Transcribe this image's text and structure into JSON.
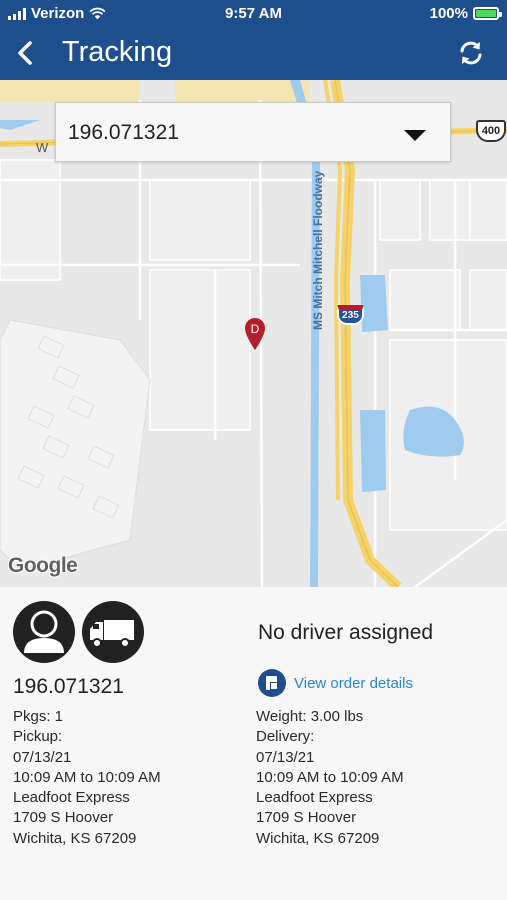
{
  "status_bar": {
    "carrier": "Verizon",
    "time": "9:57 AM",
    "battery": "100%"
  },
  "nav": {
    "title": "Tracking",
    "back_icon": "chevron-left-icon",
    "refresh_icon": "refresh-icon"
  },
  "map": {
    "selected_order": "196.071321",
    "labels": {
      "w": "W",
      "highway_400": "400",
      "interstate_235": "235",
      "floodway": "MS Mitch Mitchell Floodway",
      "pin": "D",
      "google": "Google"
    }
  },
  "details": {
    "driver_status": "No driver assigned",
    "order_id": "196.071321",
    "view_order_link": "View order details",
    "pickup": {
      "pkgs": "Pkgs: 1",
      "label": "Pickup:",
      "date": "07/13/21",
      "time_window": "10:09 AM to 10:09 AM",
      "company": "Leadfoot Express",
      "street": "1709 S Hoover",
      "city": "Wichita, KS 67209"
    },
    "delivery": {
      "weight": "Weight: 3.00 lbs",
      "label": "Delivery:",
      "date": "07/13/21",
      "time_window": "10:09 AM to 10:09 AM",
      "company": "Leadfoot Express",
      "street": "1709 S Hoover",
      "city": "Wichita, KS 67209"
    }
  },
  "colors": {
    "header": "#1e4e8c",
    "link": "#2a88c8",
    "pin": "#b3202b",
    "water": "#9fcbee",
    "highway": "#f5d36a"
  }
}
